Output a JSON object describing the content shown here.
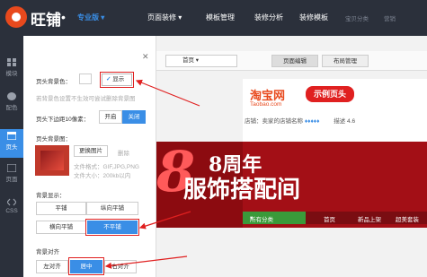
{
  "topbar": {
    "brand": "旺铺",
    "edition": "专业版",
    "nav": [
      "页面装修",
      "模板管理",
      "装修分析",
      "装修模板"
    ],
    "nav_dim": [
      "宝贝分类",
      "营销"
    ]
  },
  "sidebar": {
    "items": [
      {
        "label": "模块",
        "icon": "grid-icon"
      },
      {
        "label": "配色",
        "icon": "palette-icon"
      },
      {
        "label": "页头",
        "icon": "header-icon"
      },
      {
        "label": "页面",
        "icon": "page-icon"
      },
      {
        "label": "CSS",
        "icon": "code-icon"
      }
    ],
    "active_index": 2
  },
  "panel": {
    "header_bg_color_label": "页头背景色：",
    "show_label": "显示",
    "hint_bg_color": "若背景色设置不生效可尝试删除背景图",
    "gap_label": "页头下边距10像素：",
    "gap_on": "开启",
    "gap_off": "关闭",
    "bg_image_label": "页头背景图：",
    "change_image": "更换图片",
    "delete": "删除",
    "format_hint": "文件格式：GIF,JPG,PNG",
    "size_hint": "文件大小：200kb以内",
    "bg_display_label": "背景显示：",
    "tile": "平铺",
    "tile_v": "纵向平铺",
    "tile_h": "横向平铺",
    "no_tile": "不平铺",
    "bg_align_label": "背景对齐",
    "left": "左对齐",
    "center": "居中",
    "right": "右对齐"
  },
  "content": {
    "page_select": "首页",
    "tab_edit": "页面编辑",
    "tab_layout": "布局管理",
    "taobao": "淘宝网",
    "taobao_en": "Taobao.com",
    "example_badge": "示例页头",
    "shop_info": "店铺：卖家的店铺名称",
    "rating": "描述 4.6",
    "banner_num": "8",
    "banner_line1": "8周年",
    "banner_line2": "服饰搭配间",
    "nav": [
      "所有分类",
      "首页",
      "新品上架",
      "超美套装"
    ]
  },
  "colors": {
    "accent": "#3a8ee6",
    "dark": "#2b303b",
    "red": "#e02020",
    "banner": "#a30f16"
  }
}
